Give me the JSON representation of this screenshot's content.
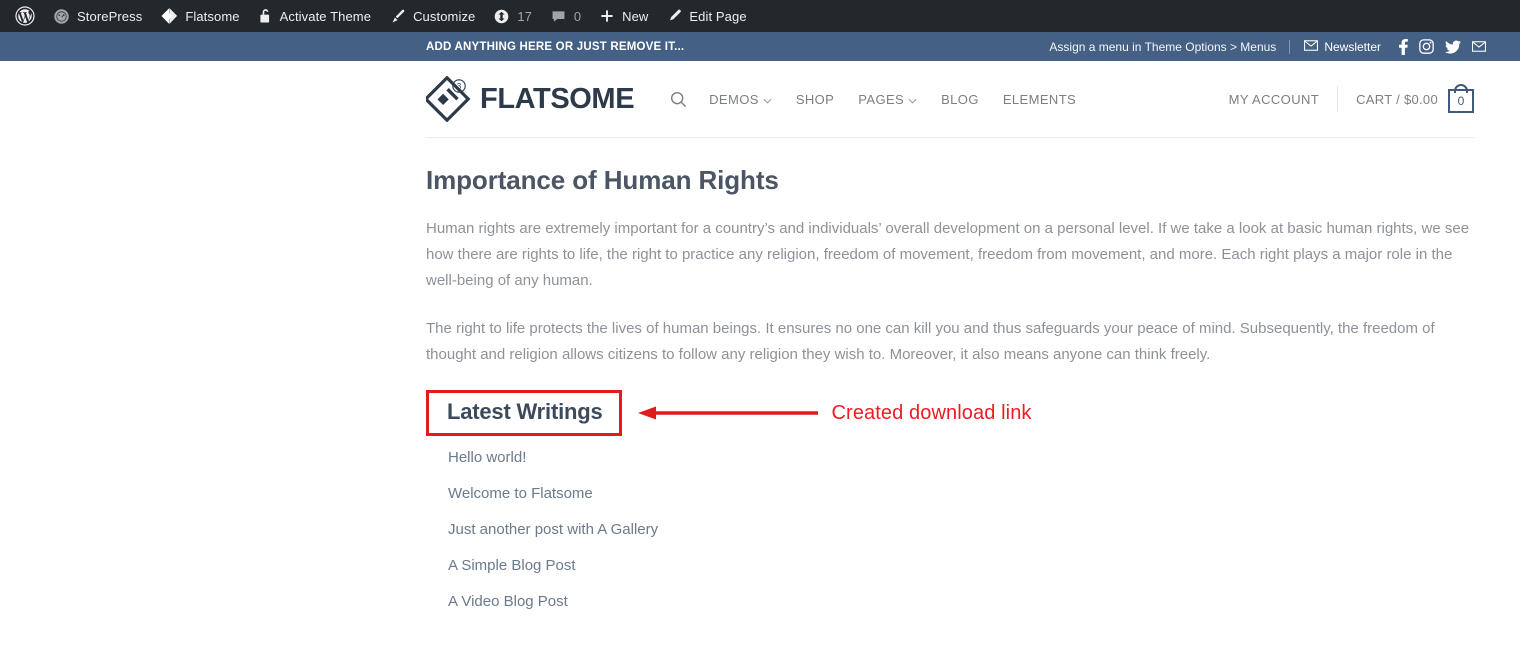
{
  "admin_bar": {
    "items": [
      {
        "icon": "wordpress-logo-icon",
        "label": "",
        "count": null
      },
      {
        "icon": "dashboard-site-icon",
        "label": "StorePress",
        "count": null
      },
      {
        "icon": "flatsome-logo-icon",
        "label": "Flatsome",
        "count": null
      },
      {
        "icon": "unlock-icon",
        "label": "Activate Theme",
        "count": null
      },
      {
        "icon": "paintbrush-icon",
        "label": "Customize",
        "count": null
      },
      {
        "icon": "update-arrows-icon",
        "label": "",
        "count": "17"
      },
      {
        "icon": "comment-bubble-icon",
        "label": "",
        "count": "0"
      },
      {
        "icon": "plus-icon",
        "label": "New",
        "count": null
      },
      {
        "icon": "pencil-icon",
        "label": "Edit Page",
        "count": null
      }
    ]
  },
  "top_bar": {
    "message": "ADD ANYTHING HERE OR JUST REMOVE IT...",
    "menu_notice": "Assign a menu in Theme Options > Menus",
    "newsletter_label": "Newsletter",
    "newsletter_icon": "envelope-icon",
    "social_icons": [
      "facebook-icon",
      "instagram-icon",
      "twitter-icon",
      "email-icon"
    ],
    "background_color": "#446084"
  },
  "header": {
    "logo_text": "FLATSOME",
    "logo_badge": "3",
    "search_icon": "search-icon",
    "nav": [
      {
        "label": "DEMOS",
        "has_dropdown": true
      },
      {
        "label": "SHOP",
        "has_dropdown": false
      },
      {
        "label": "PAGES",
        "has_dropdown": true
      },
      {
        "label": "BLOG",
        "has_dropdown": false
      },
      {
        "label": "ELEMENTS",
        "has_dropdown": false
      }
    ],
    "my_account": "MY ACCOUNT",
    "cart_label": "CART / $0.00",
    "cart_count": "0"
  },
  "main": {
    "page_title": "Importance of Human Rights",
    "paragraphs": [
      "Human rights are extremely important for a country’s and individuals’ overall development on a personal level. If we take a look at basic human rights, we see how there are rights to life, the right to practice any religion, freedom of movement, freedom from movement, and more. Each right plays a major role in the well-being of any human.",
      "The right to life protects the lives of human beings. It ensures no one can kill you and thus safeguards your peace of mind. Subsequently, the freedom of thought and religion allows citizens to follow any religion they wish to. Moreover, it also means anyone can think freely."
    ],
    "latest_writings_title": "Latest Writings",
    "posts": [
      "Hello world!",
      "Welcome to Flatsome",
      "Just another post with A Gallery",
      "A Simple Blog Post",
      "A Video Blog Post"
    ]
  },
  "annotation": {
    "text": "Created download link",
    "color": "#ed1c24",
    "highlight_target": "Latest Writings"
  }
}
